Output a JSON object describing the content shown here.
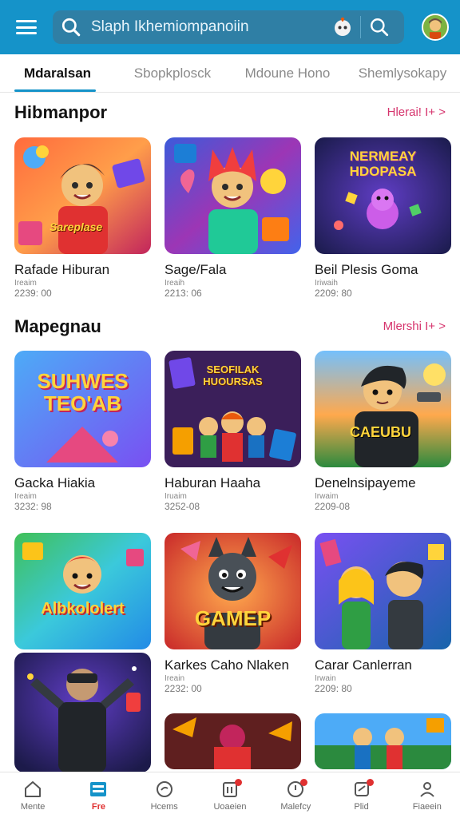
{
  "header": {
    "search_text": "Slaph Ikhemiompanoiin",
    "avatar": "user-avatar"
  },
  "tabs": [
    {
      "label": "Mdaralsan",
      "active": true
    },
    {
      "label": "Sbopkplosck",
      "active": false
    },
    {
      "label": "Mdoune Hono",
      "active": false
    },
    {
      "label": "Shemlysokapy",
      "active": false
    }
  ],
  "section1": {
    "title": "Hibmanpor",
    "see_more": "Hlerai! I+ >",
    "cards": [
      {
        "name": "Rafade Hiburan",
        "meta": "Ireaim",
        "stat": "2239: 00",
        "art": "Sareplase"
      },
      {
        "name": "Sage/Fala",
        "meta": "Ireaih",
        "stat": "2213: 06",
        "art": ""
      },
      {
        "name": "Beil Plesis Goma",
        "meta": "Iriwaih",
        "stat": "2209: 80",
        "art": "NERMEAY HDOPASA"
      }
    ]
  },
  "section2": {
    "title": "Mapegnau",
    "see_more": "Mlershi I+ >",
    "cards": [
      {
        "name": "Gacka Hiakia",
        "meta": "Ireaim",
        "stat": "3232: 98",
        "art": "SUHWES TEO'AB"
      },
      {
        "name": "Haburan Haaha",
        "meta": "Iruaim",
        "stat": "3252-08",
        "art": "SEOFILAK HUOURSAS"
      },
      {
        "name": "Denelnsipayeme",
        "meta": "Irwaim",
        "stat": "2209-08",
        "art": "CAEUBU"
      }
    ]
  },
  "section3": {
    "cards": [
      {
        "name": "",
        "meta": "",
        "stat": "",
        "art": "Albkololert"
      },
      {
        "name": "Karkes Caho Nlaken",
        "meta": "Ireain",
        "stat": "2232: 00",
        "art": "GAMEP"
      },
      {
        "name": "Carar Canlerran",
        "meta": "Irwain",
        "stat": "2209: 80",
        "art": ""
      }
    ]
  },
  "bottom_nav": [
    {
      "label": "Mente",
      "icon": "home-icon",
      "active": false,
      "badge": false
    },
    {
      "label": "Fre",
      "icon": "store-icon",
      "active": true,
      "badge": false
    },
    {
      "label": "Hcems",
      "icon": "compass-icon",
      "active": false,
      "badge": false
    },
    {
      "label": "Uoaeien",
      "icon": "calendar-icon",
      "active": false,
      "badge": true
    },
    {
      "label": "Malefcy",
      "icon": "bell-icon",
      "active": false,
      "badge": true
    },
    {
      "label": "Plid",
      "icon": "chat-icon",
      "active": false,
      "badge": true
    },
    {
      "label": "Fiaeein",
      "icon": "profile-icon",
      "active": false,
      "badge": false
    }
  ],
  "colors": {
    "topbar": "#1593c9",
    "accent": "#d6336c",
    "active_nav": "#e03131"
  }
}
